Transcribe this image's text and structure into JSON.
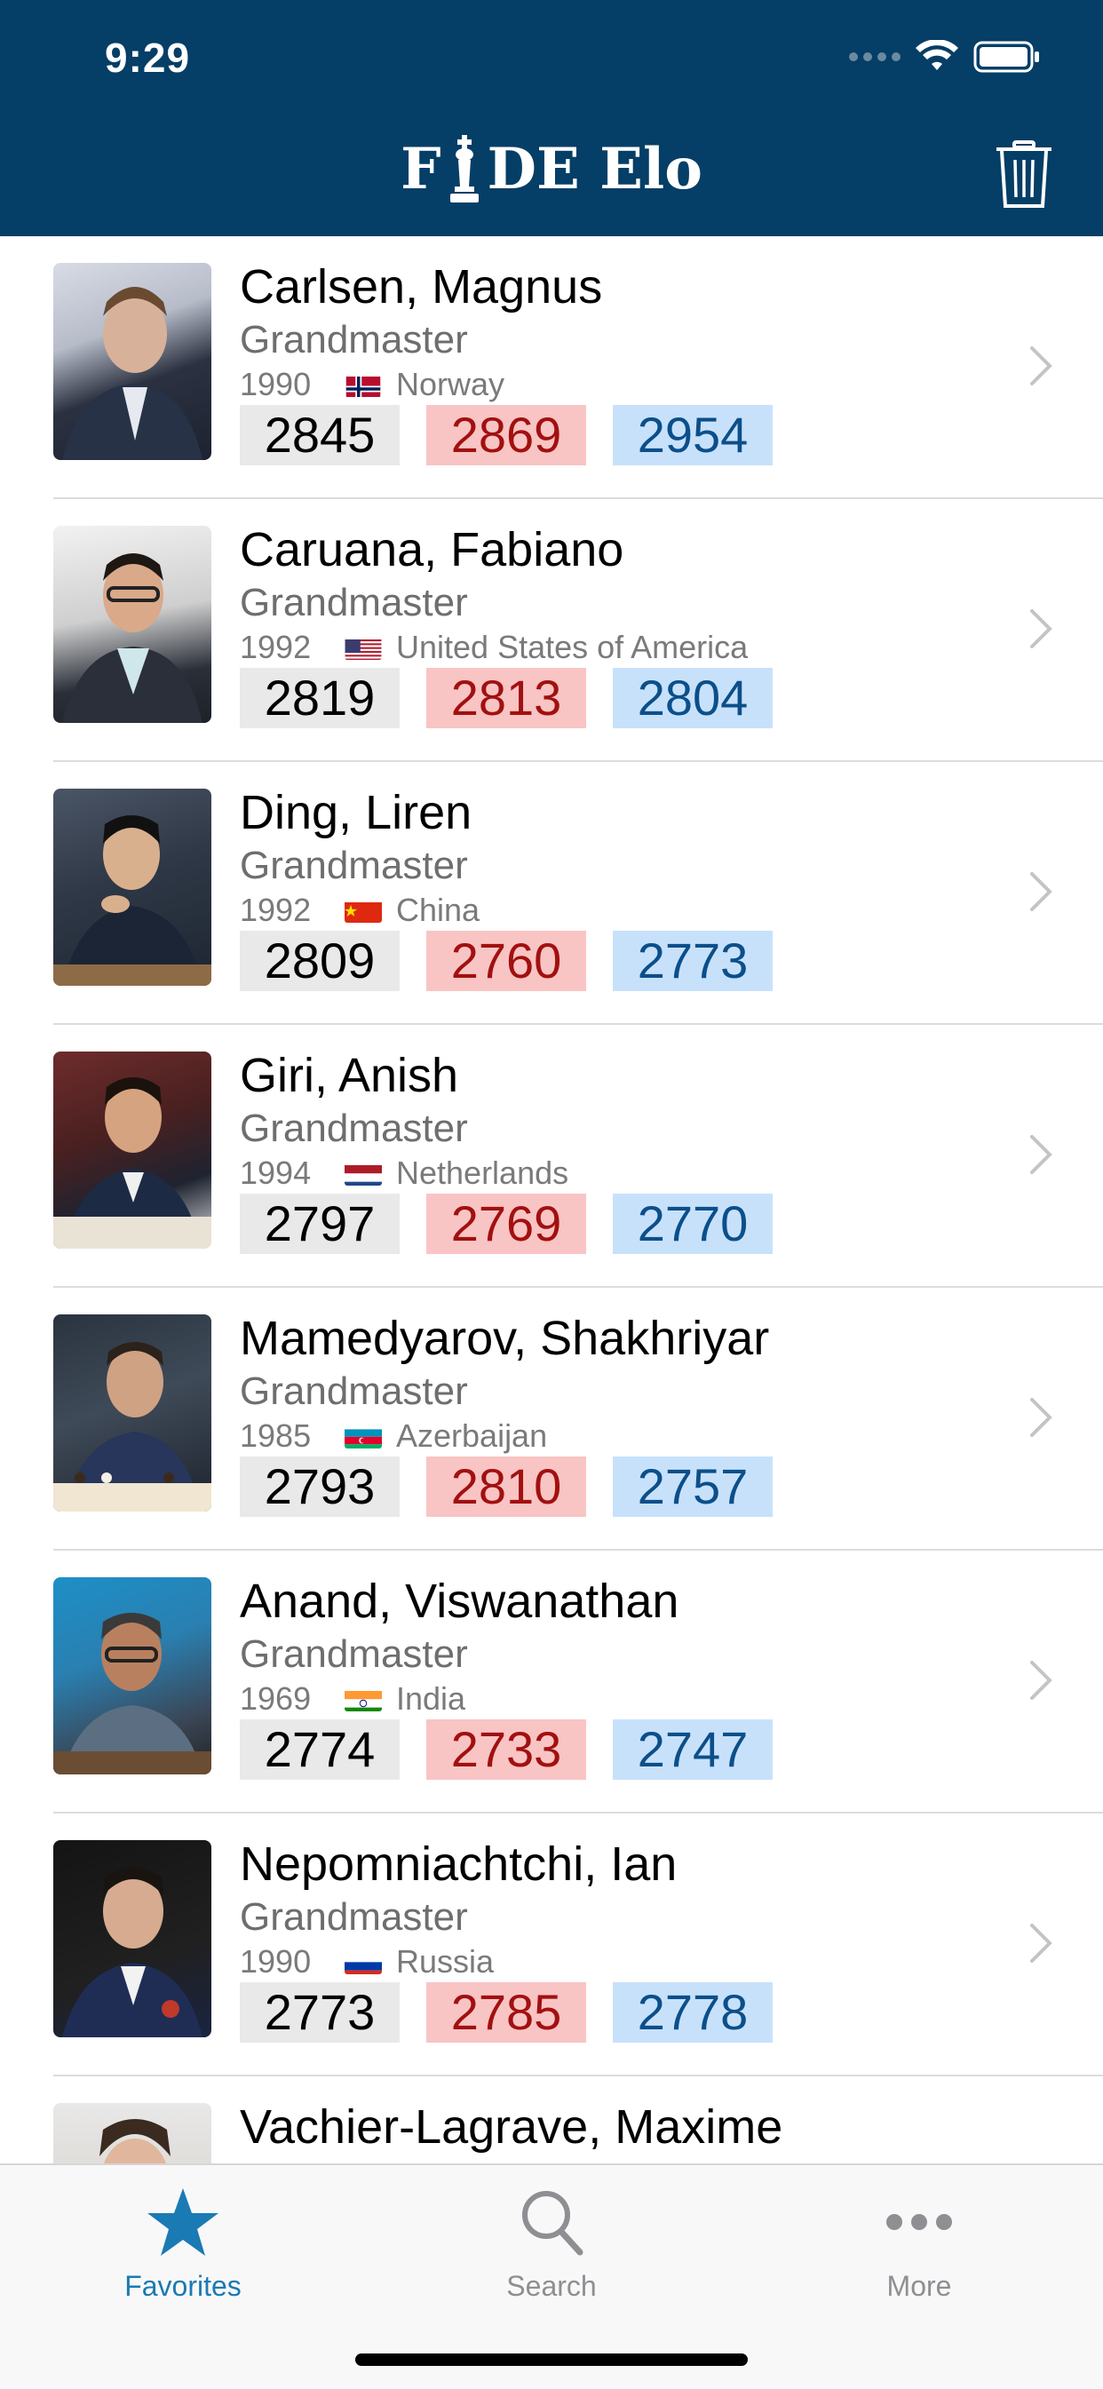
{
  "status_bar": {
    "time": "9:29"
  },
  "header": {
    "title_left": "F",
    "title_right": "DE Elo"
  },
  "players": [
    {
      "name": "Carlsen, Magnus",
      "title": "Grandmaster",
      "year": "1990",
      "country": "Norway",
      "flag": "norway",
      "std": "2845",
      "rapid": "2869",
      "blitz": "2954"
    },
    {
      "name": "Caruana, Fabiano",
      "title": "Grandmaster",
      "year": "1992",
      "country": "United States of America",
      "flag": "usa",
      "std": "2819",
      "rapid": "2813",
      "blitz": "2804"
    },
    {
      "name": "Ding, Liren",
      "title": "Grandmaster",
      "year": "1992",
      "country": "China",
      "flag": "china",
      "std": "2809",
      "rapid": "2760",
      "blitz": "2773"
    },
    {
      "name": "Giri, Anish",
      "title": "Grandmaster",
      "year": "1994",
      "country": "Netherlands",
      "flag": "netherlands",
      "std": "2797",
      "rapid": "2769",
      "blitz": "2770"
    },
    {
      "name": "Mamedyarov, Shakhriyar",
      "title": "Grandmaster",
      "year": "1985",
      "country": "Azerbaijan",
      "flag": "azerbaijan",
      "std": "2793",
      "rapid": "2810",
      "blitz": "2757"
    },
    {
      "name": "Anand, Viswanathan",
      "title": "Grandmaster",
      "year": "1969",
      "country": "India",
      "flag": "india",
      "std": "2774",
      "rapid": "2733",
      "blitz": "2747"
    },
    {
      "name": "Nepomniachtchi, Ian",
      "title": "Grandmaster",
      "year": "1990",
      "country": "Russia",
      "flag": "russia",
      "std": "2773",
      "rapid": "2785",
      "blitz": "2778"
    },
    {
      "name": "Vachier-Lagrave, Maxime",
      "title": "",
      "year": "",
      "country": "",
      "flag": "",
      "std": "",
      "rapid": "",
      "blitz": ""
    }
  ],
  "tabs": [
    {
      "label": "Favorites",
      "icon": "star-icon",
      "active": true
    },
    {
      "label": "Search",
      "icon": "search-icon",
      "active": false
    },
    {
      "label": "More",
      "icon": "more-icon",
      "active": false
    }
  ],
  "colors": {
    "header_bg": "#053e66",
    "accent": "#1a7ab4",
    "rapid_bg": "#f9c4c4",
    "blitz_bg": "#c8e1fb",
    "standard_bg": "#e9e9e9"
  }
}
